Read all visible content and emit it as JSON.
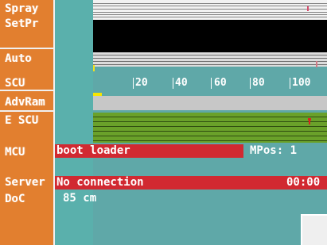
{
  "labels": {
    "spray": "Spray",
    "setpr": "SetPr",
    "auto": "Auto",
    "scu": "SCU",
    "advram": "AdvRam",
    "escu": "E SCU",
    "mcu": "MCU",
    "server": "Server",
    "doc": "DoC"
  },
  "scale": {
    "ticks": [
      "20",
      "40",
      "60",
      "80",
      "100"
    ]
  },
  "mcu": {
    "status": "boot loader",
    "mpos_label": "MPos: 1"
  },
  "server": {
    "status": "No connection",
    "time": "00:00"
  },
  "doc": {
    "value": "85 cm"
  },
  "colors": {
    "label_bg": "#e27f2f",
    "panel_bg": "#5fa8a8",
    "status_red": "#d12931",
    "advram_bar": "#c7c7c7",
    "escu_green": "#6aa12a",
    "marker_yellow": "#f7e600"
  }
}
